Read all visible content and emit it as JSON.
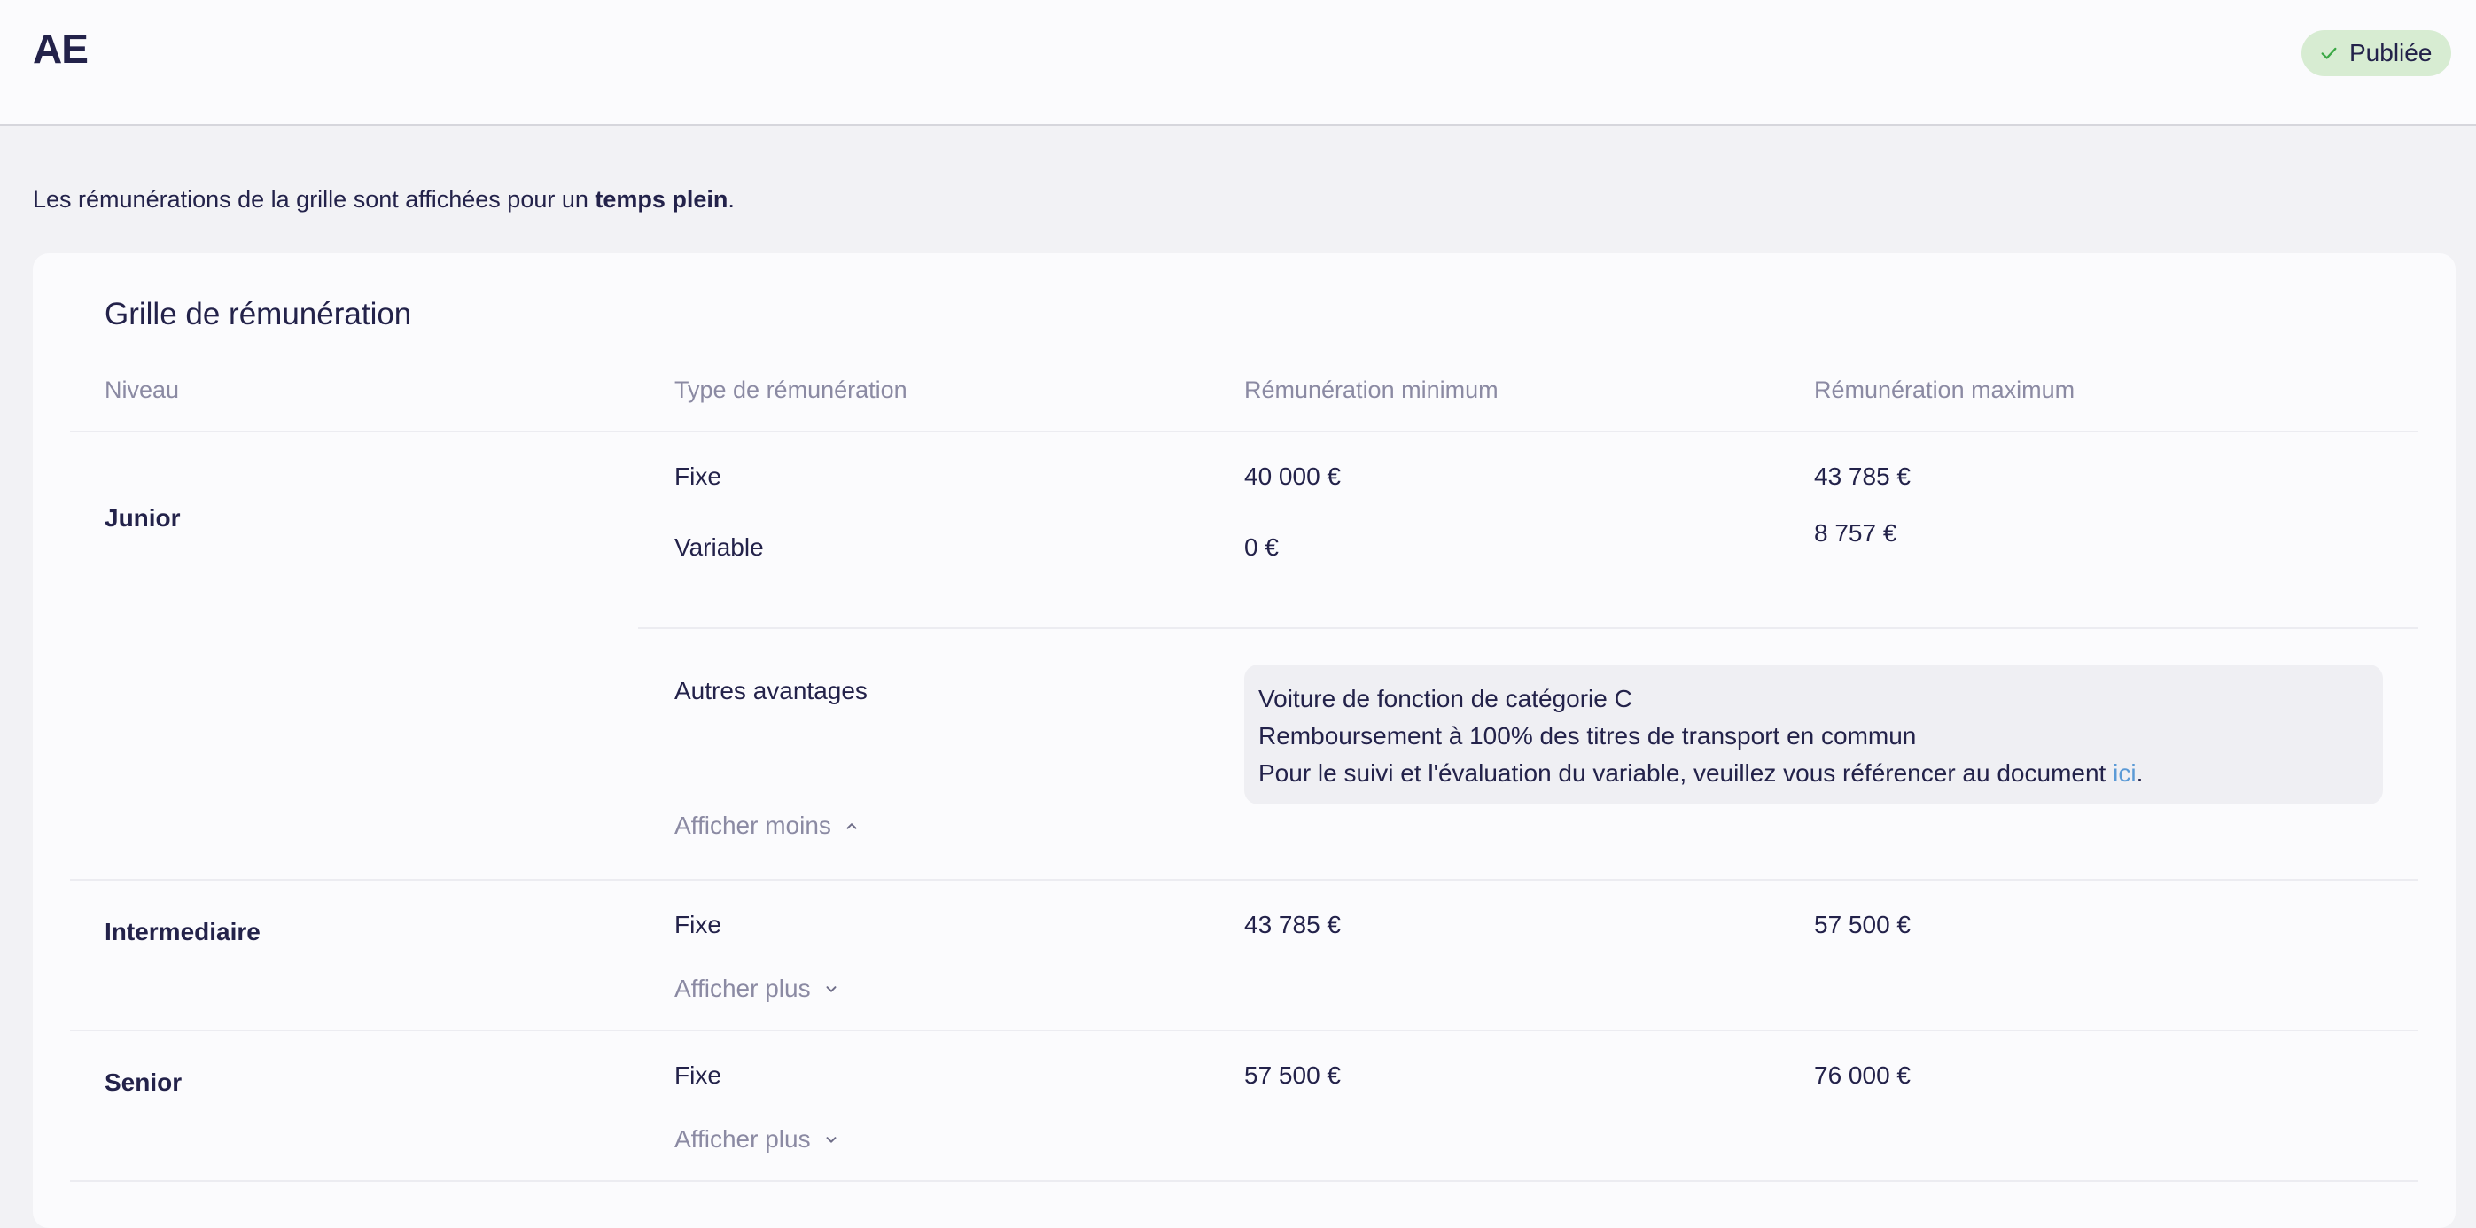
{
  "header": {
    "title": "AE",
    "status": "Publiée",
    "status_icon": "check-icon",
    "status_color": "#d7ecd2"
  },
  "intro": {
    "prefix": "Les rémunérations de la grille sont affichées pour un ",
    "bold": "temps plein",
    "suffix": "."
  },
  "grid": {
    "title": "Grille de rémunération",
    "columns": [
      "Niveau",
      "Type de rémunération",
      "Rémunération minimum",
      "Rémunération maximum"
    ],
    "levels": [
      {
        "name": "Junior",
        "rows": [
          {
            "type": "Fixe",
            "min": "40 000 €",
            "max": "43 785 €"
          },
          {
            "type": "Variable",
            "min": "0 €",
            "max": "8 757 €"
          }
        ],
        "benefits_label": "Autres avantages",
        "benefits": {
          "line1": "Voiture de fonction de catégorie C",
          "line2": "Remboursement à 100% des titres de transport en commun",
          "line3_prefix": "Pour le suivi et l'évaluation du variable, veuillez vous référencer au document ",
          "line3_link": "ici",
          "line3_suffix": "."
        },
        "toggle_label": "Afficher moins",
        "toggle_icon": "chevron-up-icon"
      },
      {
        "name": "Intermediaire",
        "rows": [
          {
            "type": "Fixe",
            "min": "43 785 €",
            "max": "57 500 €"
          }
        ],
        "toggle_label": "Afficher plus",
        "toggle_icon": "chevron-down-icon"
      },
      {
        "name": "Senior",
        "rows": [
          {
            "type": "Fixe",
            "min": "57 500 €",
            "max": "76 000 €"
          }
        ],
        "toggle_label": "Afficher plus",
        "toggle_icon": "chevron-down-icon"
      }
    ]
  },
  "colors": {
    "text": "#23224a",
    "muted": "#8b8aa3",
    "link": "#5b9ad6",
    "background": "#f2f2f5"
  }
}
